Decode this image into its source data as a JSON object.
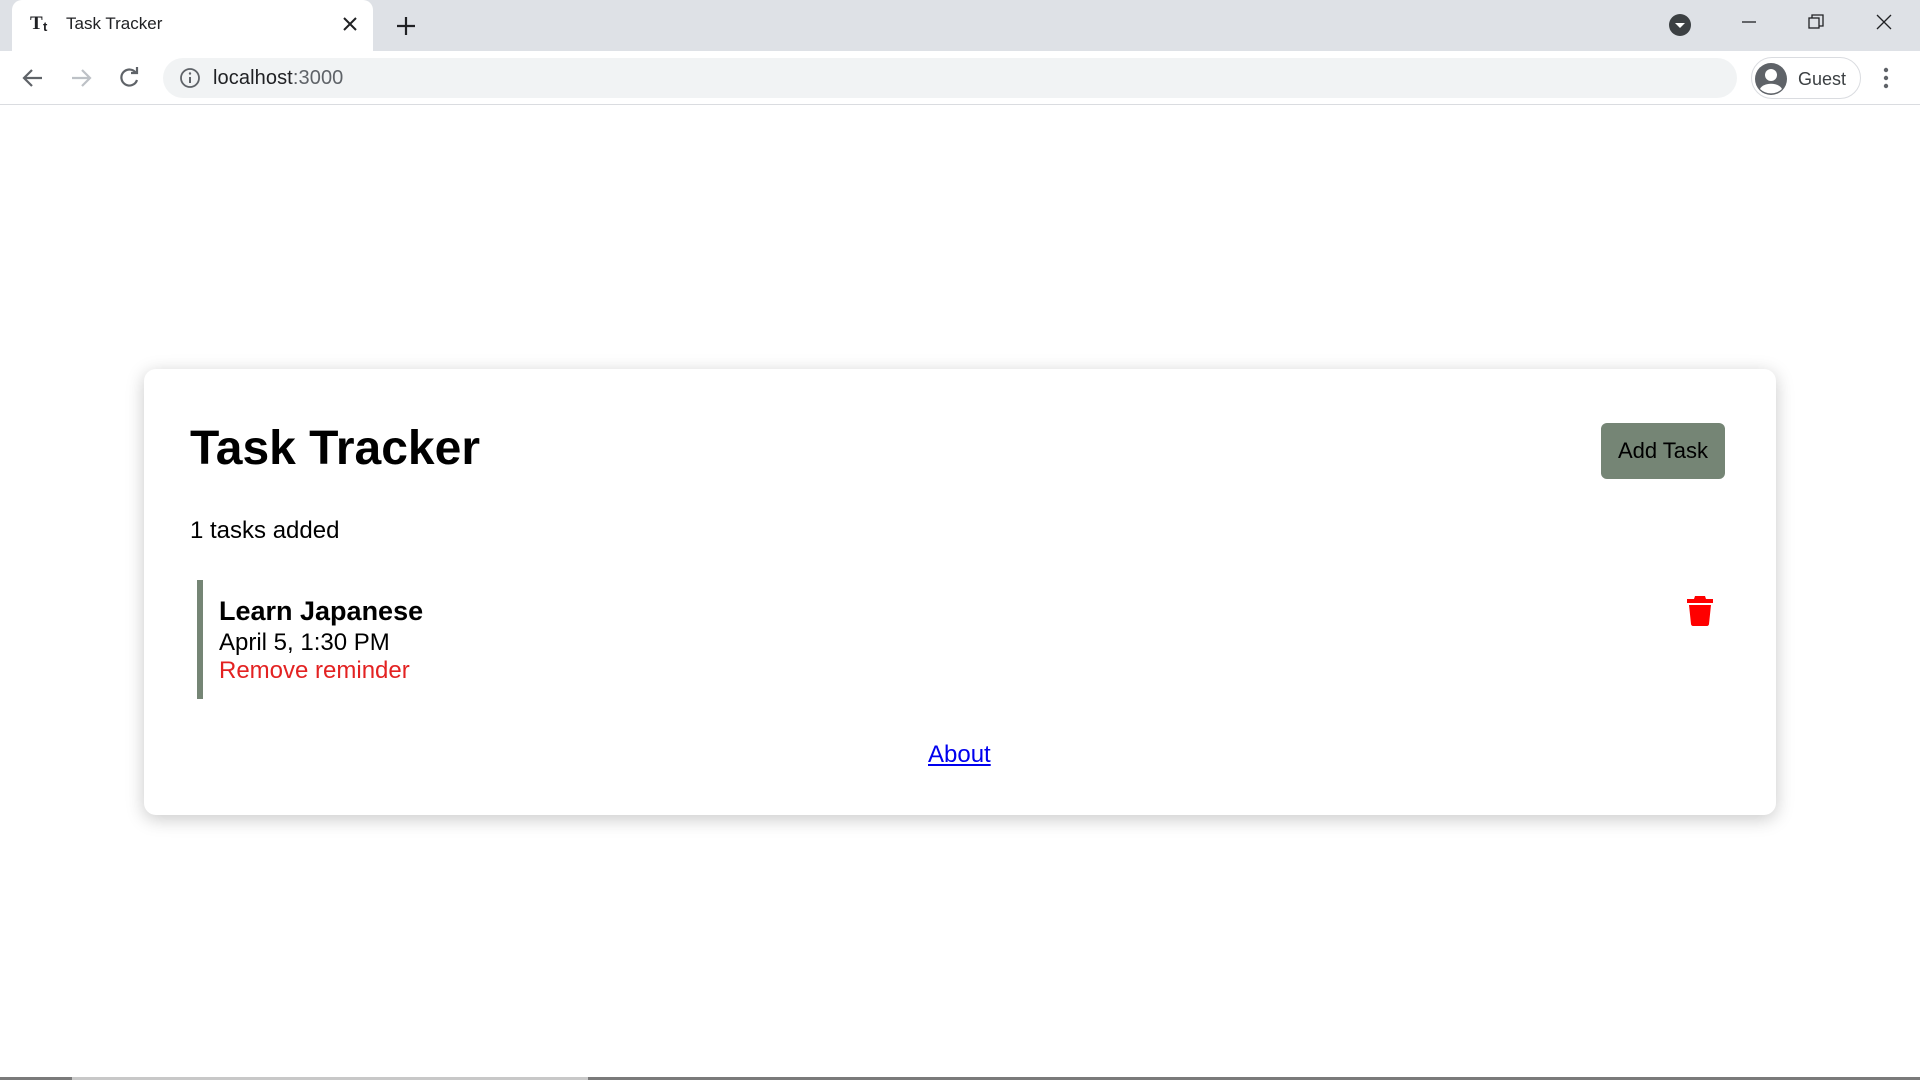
{
  "browser": {
    "tab": {
      "title": "Task Tracker",
      "favicon": "task-tracker-favicon"
    },
    "url": {
      "host": "localhost",
      "port": ":3000"
    },
    "profile": {
      "label": "Guest"
    }
  },
  "app": {
    "title": "Task Tracker",
    "add_button_label": "Add Task",
    "task_count_text": "1 tasks added",
    "tasks": [
      {
        "text": "Learn Japanese",
        "day": "April 5, 1:30 PM",
        "reminder_action": "Remove reminder"
      }
    ],
    "footer_link": "About"
  },
  "colors": {
    "accent": "#758575",
    "delete": "#ff0000",
    "reminder_text": "#e32222",
    "link": "#0000ee"
  }
}
